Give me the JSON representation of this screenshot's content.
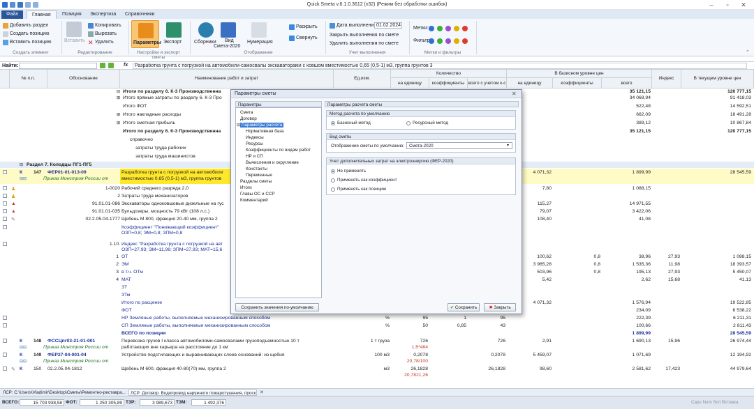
{
  "title": "Quick Smeta v.6.1.0.3612 (x32) (Режим без обработки ошибок)",
  "tabs": [
    "Файл",
    "Главная",
    "Позиция",
    "Экспертиза",
    "Справочники"
  ],
  "ribbon": {
    "add_section": "Добавить раздел",
    "create_position": "Создать позицию",
    "insert_position": "Вставить позицию",
    "group_create": "Создать элемент",
    "insert": "Вставить",
    "copy": "Копировать",
    "cut": "Вырезать",
    "delete": "Удалить",
    "group_edit": "Редактирование",
    "params": "Параметры",
    "export": "Экспорт",
    "group_settings": "Настройки и экспорт сметы",
    "collections": "Сборники",
    "view": "Вид",
    "view_sub": "Смета-2020",
    "numbering": "Нумерация",
    "expand": "Раскрыть",
    "collapse": "Свернуть",
    "group_display": "Отображение",
    "exec_date_label": "Дата выполнения",
    "exec_date": "01.02.2024",
    "close_exec": "Закрыть выполнения по смете",
    "delete_exec": "Удалить выполнения по смете",
    "group_exec": "Учет выполнения",
    "marks": "Метки:",
    "filter": "Фильтр:",
    "group_marks": "Метки и фильтры",
    "mark_colors": [
      "#2f6fd6",
      "#3cae3a",
      "#9b4fc9",
      "#e0b000",
      "#e23a2a"
    ]
  },
  "formula_bar": {
    "find_label": "Найти:",
    "fx": "fx",
    "formula": "Разработка грунта с погрузкой на автомобили-самосвалы экскаваторами с ковшом вместимостью 0,65 (0,5-1) м3, группа грунтов 3"
  },
  "headers": {
    "num": "№ п.п.",
    "basis": "Обоснование",
    "name": "Наименование работ и затрат",
    "unit": "Ед.изм.",
    "qty": "Количество",
    "per_unit": "на единицу",
    "coef": "коэффициенты",
    "total_coef": "всего с учетом к-с",
    "base_level": "В базисном уровне цен",
    "b_unit": "на единицу",
    "b_coef": "коэффициенты",
    "b_total": "всего",
    "index": "Индекс",
    "current": "В текущем уровне цен"
  },
  "rows": [
    {
      "name": "Итоги по разделу 6. К-3 Производственна",
      "b_total": "35 121,15",
      "cur": "120 777,15",
      "bold": true
    },
    {
      "name": "Итого прямые затраты по разделу 6. К-3 Про",
      "b_total": "34 069,94",
      "cur": "91 418,03"
    },
    {
      "name": "Итого ФОТ",
      "b_total": "522,48",
      "cur": "14 592,51"
    },
    {
      "name": "Итого накладные расходы",
      "b_total": "662,09",
      "cur": "18 491,28"
    },
    {
      "name": "Итого сметная прибыль",
      "b_total": "389,12",
      "cur": "10 867,84"
    },
    {
      "name": "Итого по разделу 6. К-3 Производственна",
      "b_total": "35 121,15",
      "cur": "120 777,15",
      "bold": true
    },
    {
      "name": "справочно"
    },
    {
      "name": "затраты труда рабочих"
    },
    {
      "name": "затраты труда машинистов"
    }
  ],
  "section7": "Раздел 7. Колодцы ПГ1-ПГ5",
  "pos147": {
    "k": "К",
    "num": "147",
    "code": "ФЕР01-01-013-09",
    "order": "Приказ Минстроя России от",
    "name1": "Разработка грунта с погрузкой на автомобили",
    "name2": "вместимостью 0,65 (0,5-1) м3, группа грунтов",
    "b_unit": "4 071,32",
    "b_total": "1 899,99",
    "cur": "28 545,59"
  },
  "res": [
    {
      "code": "1-0020",
      "name": "Рабочий среднего разряда 2,0",
      "b_unit": "7,80",
      "b_total": "1 088,15"
    },
    {
      "code": "2",
      "name": "Затраты труда механизаторов",
      "b_unit": "",
      "b_total": ""
    },
    {
      "code": "91.01.01-086",
      "name": "Экскаваторы одноковшовые дизельные на гус",
      "b_unit": "115,27",
      "b_total": "14 971,55"
    },
    {
      "code": "91.01.01-035",
      "name": "Бульдозеры, мощность 79 кВт (108 л.с.)",
      "b_unit": "79,07",
      "b_total": "3 422,06"
    },
    {
      "code": "02.2.05.04-1777",
      "name": "Щебень М 800, фракция 20-40 мм, группа 2",
      "b_unit": "108,40",
      "b_total": "41,08"
    }
  ],
  "coef1": "Коэффициент \"Понижающий коэффициент\"",
  "coef2": "ОЗП=0,8; ЭМ=0,8; ЗПМ=0,8",
  "idx_code": "1.10.",
  "idx1": "Индекс \"Разработка грунта с погрузкой на авт",
  "idx2": "ОЗП=27,93; ЭМ=11,98; ЗПМ=27,93; МАТ=15,6",
  "costs": [
    {
      "n": "1",
      "name": "ОТ",
      "b_unit": "100,62",
      "b_coef": "0,8",
      "b_total": "38,96",
      "idx": "27,93",
      "cur": "1 088,15"
    },
    {
      "n": "2",
      "name": "ЭМ",
      "b_unit": "3 965,28",
      "b_coef": "0,8",
      "b_total": "1 535,36",
      "idx": "11,98",
      "cur": "18 393,57"
    },
    {
      "n": "3",
      "name": "в т.ч. ОТм",
      "b_unit": "503,96",
      "b_coef": "0,8",
      "b_total": "195,13",
      "idx": "27,93",
      "cur": "5 450,07"
    },
    {
      "n": "4",
      "name": "МАТ",
      "b_unit": "5,42",
      "b_coef": "",
      "b_total": "2,62",
      "idx": "15,68",
      "cur": "41,13"
    },
    {
      "n": "",
      "name": "ЗТ",
      "b_unit": "",
      "b_coef": "",
      "b_total": "",
      "idx": "",
      "cur": ""
    },
    {
      "n": "",
      "name": "ЗТм",
      "b_unit": "",
      "b_coef": "",
      "b_total": "",
      "idx": "",
      "cur": ""
    },
    {
      "n": "",
      "name": "Итого по расценке",
      "b_unit": "4 071,32",
      "b_coef": "",
      "b_total": "1 576,94",
      "idx": "",
      "cur": "19 522,85"
    },
    {
      "n": "",
      "name": "ФОТ",
      "b_unit": "",
      "b_coef": "",
      "b_total": "234,09",
      "idx": "",
      "cur": "6 538,22"
    }
  ],
  "nr": {
    "name": "НР Земляные работы, выполняемые механизированным способом",
    "unit": "%",
    "pu": "95",
    "coef": "1",
    "tot": "95",
    "b_total": "222,39",
    "cur": "6 211,31"
  },
  "sp": {
    "name": "СП Земляные работы, выполняемые механизированным способом",
    "unit": "%",
    "pu": "50",
    "coef": "0,85",
    "tot": "43",
    "b_total": "100,66",
    "cur": "2 811,43"
  },
  "vsego": {
    "name": "ВСЕГО по позиции",
    "b_total": "1 899,99",
    "cur": "28 545,59"
  },
  "pos148": {
    "k": "К",
    "num": "148",
    "code": "ФССЦпг03-21-01-001",
    "order": "Приказ Минстроя России от",
    "name1": "Перевозка грузов I класса автомобилями-самосвалами грузоподъемностью 10 т",
    "name2": "работающих вне карьера на расстояние до 1 км",
    "unit": "1 т груза",
    "pu": "726",
    "pu2": "1,5*484",
    "tot": "726",
    "b_unit": "2,91",
    "b_total": "1 690,13",
    "idx": "15,96",
    "cur": "26 974,44"
  },
  "pos149": {
    "k": "К",
    "num": "149",
    "code": "ФЕР27-04-001-04",
    "order": "Приказ Минстроя России от",
    "name1": "Устройство подстилающих и выравнивающих слоев оснований: из щебня",
    "unit": "100 м3",
    "pu": "0,2078",
    "pu2": "20,78/100",
    "tot": "0,2078",
    "b_unit": "5 459,07",
    "b_total": "1 071,69",
    "cur": "12 194,92"
  },
  "pos150": {
    "k": "К",
    "num": "150",
    "code": "02.2.05.04-1812",
    "name1": "Щебень М 600, фракция 40-80(70) мм, группа 2",
    "unit": "м3",
    "pu": "26,1828",
    "pu2": "20,7821,26",
    "tot": "26,1828",
    "b_unit": "98,60",
    "b_total": "2 581,62",
    "idx": "17,423",
    "cur": "44 979,64"
  },
  "dialog": {
    "title": "Параметры сметы",
    "tree_header": "Параметры",
    "right_header": "Параметры расчета сметы",
    "tree": [
      "Смета",
      "Договор",
      "Параметры расчета",
      "Нормативная база",
      "Индексы",
      "Ресурсы",
      "Коэффициенты по видам работ",
      "НР и СП",
      "Вычисления и округление",
      "Константы",
      "Переменные",
      "Разделы сметы",
      "Итоги",
      "Главы ОС и ССР",
      "Комментарий"
    ],
    "method_title": "Метод расчета по умолчанию",
    "method_basis": "Базисный метод",
    "method_resource": "Ресурсный метод",
    "view_title": "Вид сметы",
    "view_label": "Отображение сметы по умолчанию:",
    "view_value": "Смета-2020",
    "energy_title": "Учет дополнительных затрат на электроэнергию (ФЕР-2020)",
    "opt1": "Не применять",
    "opt2": "Применять как коэффициент",
    "opt3": "Применять как позицию",
    "save_default": "Сохранить значения по-умолчанию",
    "save": "Сохранить",
    "close": "Закрыть"
  },
  "doc_tabs": [
    "ЛСР: C:\\Users\\Vladimir\\Desktop\\Сметы\\Ремонтно-реставра...",
    "ЛСР: Договор. Водопровод наружного пожаротушения, проск..."
  ],
  "status": {
    "vsego_l": "ВСЕГО:",
    "vsego": "15 703 938,58",
    "fot_l": "ФОТ:",
    "fot": "1 250 305,89",
    "tzr_l": "ТЗР:",
    "tzr": "3 989,673",
    "tzm_l": "ТЗМ:",
    "tzm": "1 492,376",
    "right": "Caps  Num  Scrl  Вставка"
  }
}
